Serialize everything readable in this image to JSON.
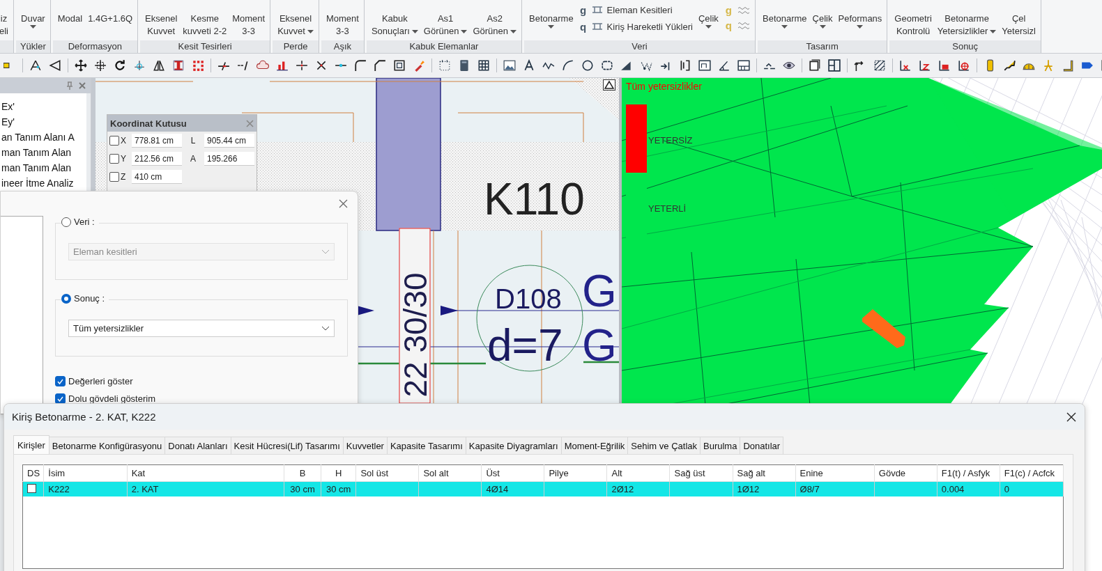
{
  "ribbon": {
    "groups": [
      {
        "buttons": [
          {
            "kind": "large",
            "lines": [
              "iz",
              "eli"
            ],
            "dropdown": false
          }
        ]
      },
      {
        "title": "Yükler",
        "buttons": [
          {
            "kind": "large",
            "lines": [
              "Duvar"
            ],
            "dropdown": true
          }
        ]
      },
      {
        "title": "Deformasyon",
        "buttons": [
          {
            "kind": "large",
            "lines": [
              "Modal"
            ],
            "dropdown": false
          },
          {
            "kind": "large",
            "lines": [
              "1.4G+1.6Q"
            ],
            "dropdown": false
          }
        ]
      },
      {
        "title": "Kesit Tesirleri",
        "buttons": [
          {
            "kind": "large",
            "lines": [
              "Eksenel",
              "Kuvvet"
            ],
            "dropdown": false
          },
          {
            "kind": "large",
            "lines": [
              "Kesme",
              "kuvveti 2-2"
            ],
            "dropdown": false
          },
          {
            "kind": "large",
            "lines": [
              "Moment",
              "3-3"
            ],
            "dropdown": false
          }
        ]
      },
      {
        "title": "Perde",
        "buttons": [
          {
            "kind": "large",
            "lines": [
              "Eksenel",
              "Kuvvet"
            ],
            "dropdown": true
          }
        ]
      },
      {
        "title": "Aşık",
        "buttons": [
          {
            "kind": "large",
            "lines": [
              "Moment",
              "3-3"
            ],
            "dropdown": false
          }
        ]
      },
      {
        "title": "Kabuk Elemanlar",
        "buttons": [
          {
            "kind": "large",
            "lines": [
              "Kabuk",
              "Sonuçları"
            ],
            "dropdown": true
          },
          {
            "kind": "large",
            "lines": [
              "As1",
              "Görünen"
            ],
            "dropdown": true
          },
          {
            "kind": "large",
            "lines": [
              "As2",
              "Görünen"
            ],
            "dropdown": true
          }
        ]
      },
      {
        "title": "Veri",
        "buttons": [
          {
            "kind": "large",
            "lines": [
              "Betonarme"
            ],
            "dropdown": true
          },
          {
            "kind": "small",
            "items": [
              {
                "symbol": "g",
                "label": "Eleman Kesitleri"
              },
              {
                "symbol": "q",
                "label": "Kiriş Hareketli Yükleri"
              }
            ]
          },
          {
            "kind": "large",
            "lines": [
              "Çelik"
            ],
            "dropdown": true
          },
          {
            "kind": "glyphs",
            "symbols": [
              "g",
              "q"
            ]
          }
        ]
      },
      {
        "title": "Tasarım",
        "buttons": [
          {
            "kind": "large",
            "lines": [
              "Betonarme"
            ],
            "dropdown": true
          },
          {
            "kind": "large",
            "lines": [
              "Çelik"
            ],
            "dropdown": true
          },
          {
            "kind": "large",
            "lines": [
              "Peformans"
            ],
            "dropdown": true
          }
        ]
      },
      {
        "title": "Sonuç",
        "buttons": [
          {
            "kind": "large",
            "lines": [
              "Geometri",
              "Kontrolü"
            ],
            "dropdown": false
          },
          {
            "kind": "large",
            "lines": [
              "Betonarme",
              "Yetersizlikler"
            ],
            "dropdown": true
          },
          {
            "kind": "large",
            "lines": [
              "Çel",
              "Yetersizl"
            ],
            "dropdown": false
          }
        ]
      }
    ]
  },
  "side_panel": {
    "items": [
      "Ex'",
      "Ey'",
      "an Tanım Alanı A",
      "man Tanım Alan",
      "man Tanım Alan",
      "ineer İtme Analiz"
    ]
  },
  "drawing": {
    "labels": [
      {
        "kind": "beam",
        "text": "K110"
      },
      {
        "kind": "section",
        "text": "22 30/30"
      },
      {
        "kind": "tag",
        "text": "D108"
      },
      {
        "kind": "tag",
        "text": "d=7"
      },
      {
        "kind": "axis",
        "text": "G"
      },
      {
        "kind": "axis",
        "text": "G"
      }
    ]
  },
  "model_view": {
    "title": "Tüm yetersizlikler",
    "legend": [
      {
        "label": "YETERSİZ",
        "color": "#ff0000"
      },
      {
        "label": "YETERLİ",
        "color": "#00e64d"
      }
    ]
  },
  "coordinate_box": {
    "title": "Koordinat Kutusu",
    "rows": [
      {
        "axis": "X",
        "checked": false,
        "value": "778.81 cm",
        "label": "L",
        "value_2": "905.44 cm"
      },
      {
        "axis": "Y",
        "checked": false,
        "value": "212.56 cm",
        "label": "A",
        "value_2": "195.266"
      },
      {
        "axis": "Z",
        "checked": false,
        "value": "410 cm"
      }
    ]
  },
  "display_dialog": {
    "sources": [
      {
        "label": "Veri :",
        "selected": false,
        "choice": "Eleman kesitleri"
      },
      {
        "label": "Sonuç :",
        "selected": true,
        "choice": "Tüm yetersizlikler"
      }
    ],
    "options": [
      {
        "label": "Değerleri göster",
        "checked": true
      },
      {
        "label": "Dolu gövdeli gösterim",
        "checked": true
      }
    ]
  },
  "beam_dialog": {
    "title": "Kiriş Betonarme - 2. KAT, K222",
    "tabs": [
      {
        "label": "Kirişler",
        "selected": true
      },
      {
        "label": "Betonarme Konfigürasyonu",
        "selected": false
      },
      {
        "label": "Donatı Alanları",
        "selected": false
      },
      {
        "label": "Kesit Hücresi(Lif) Tasarımı",
        "selected": false
      },
      {
        "label": "Kuvvetler",
        "selected": false
      },
      {
        "label": "Kapasite Tasarımı",
        "selected": false
      },
      {
        "label": "Kapasite Diyagramları",
        "selected": false
      },
      {
        "label": "Moment-Eğrilik",
        "selected": false
      },
      {
        "label": "Sehim ve Çatlak",
        "selected": false
      },
      {
        "label": "Burulma",
        "selected": false
      },
      {
        "label": "Donatılar",
        "selected": false
      }
    ],
    "table": {
      "columns": [
        "DS",
        "İsim",
        "Kat",
        "B",
        "H",
        "Sol üst",
        "Sol alt",
        "Üst",
        "Pilye",
        "Alt",
        "Sağ üst",
        "Sağ alt",
        "Enine",
        "Gövde",
        "F1(t) / Asfyk",
        "F1(c) / Acfck"
      ],
      "rows": [
        {
          "selected": true,
          "ds_checked": false,
          "cells": [
            null,
            "K222",
            "2. KAT",
            "30 cm",
            "30 cm",
            null,
            null,
            "4Ø14",
            null,
            "2Ø12",
            null,
            "1Ø12",
            "Ø8/7",
            null,
            "0.004",
            "0"
          ]
        }
      ]
    }
  }
}
